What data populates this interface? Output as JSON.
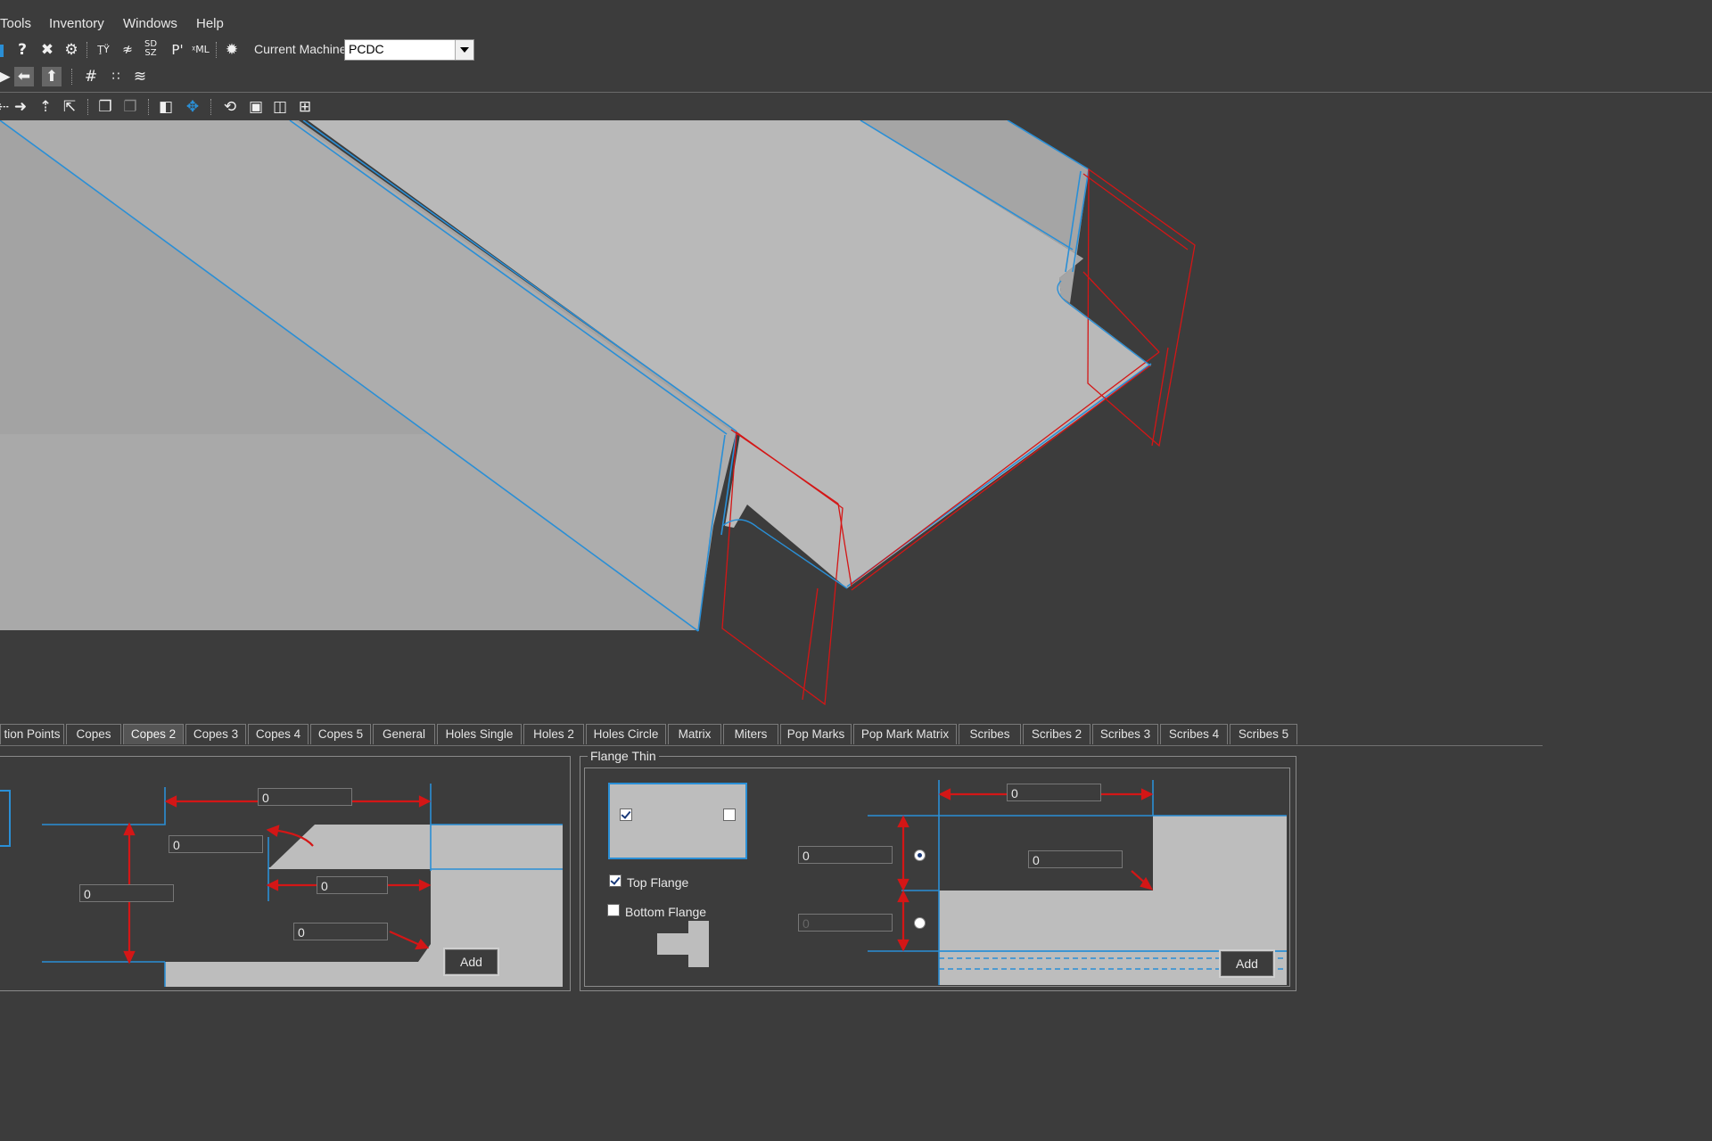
{
  "menu": {
    "items": [
      "Tools",
      "Inventory",
      "Windows",
      "Help"
    ]
  },
  "toolbar": {
    "machine_label": "Current Machine",
    "machine_value": "PCDC"
  },
  "tabs": [
    "tion Points",
    "Copes",
    "Copes 2",
    "Copes 3",
    "Copes 4",
    "Copes 5",
    "General",
    "Holes Single",
    "Holes 2",
    "Holes Circle",
    "Matrix",
    "Miters",
    "Pop Marks",
    "Pop Mark Matrix",
    "Scribes",
    "Scribes 2",
    "Scribes 3",
    "Scribes 4",
    "Scribes 5"
  ],
  "active_tab": "Copes 2",
  "cope_panel": {
    "fields": [
      "0",
      "0",
      "0",
      "0",
      "0"
    ],
    "add_label": "Add"
  },
  "flange_panel": {
    "title": "Flange Thin",
    "top_flange_label": "Top Flange",
    "top_flange_checked": true,
    "bottom_flange_label": "Bottom Flange",
    "bottom_flange_checked": false,
    "fields": [
      "0",
      "0",
      "0"
    ],
    "disabled_field": "0",
    "add_label": "Add"
  },
  "colors": {
    "background": "#3c3c3c",
    "accent_blue": "#2a8fd6",
    "accent_red": "#d41616",
    "part_gray": "#bdbdbd"
  }
}
